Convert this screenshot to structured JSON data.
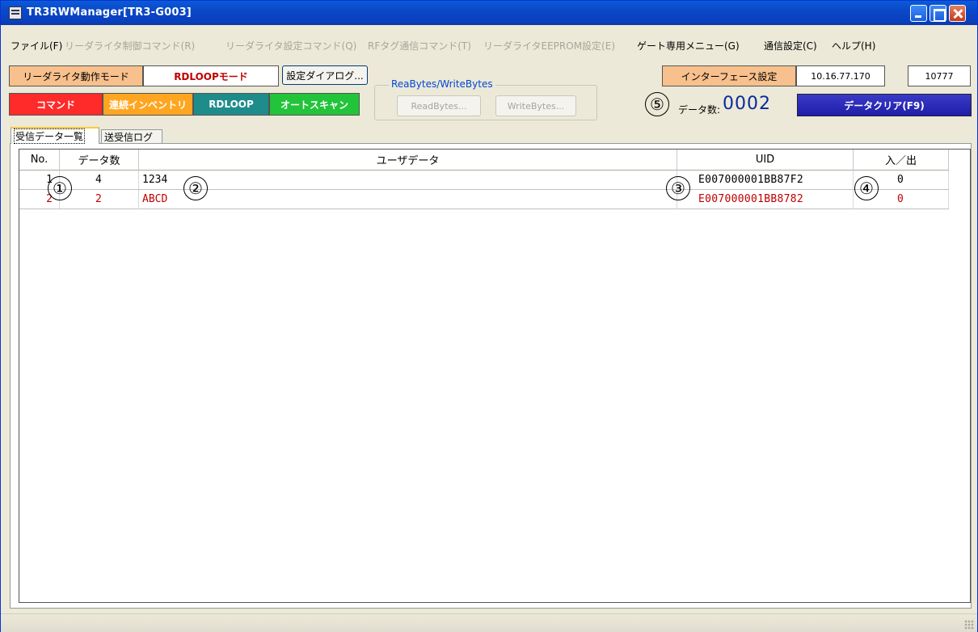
{
  "window": {
    "title": "TR3RWManager[TR3-G003]"
  },
  "menu": {
    "items": [
      {
        "label": "ファイル(F)",
        "enabled": true
      },
      {
        "label": "リーダライタ制御コマンド(R)",
        "enabled": false
      },
      {
        "label": "リーダライタ設定コマンド(Q)",
        "enabled": false
      },
      {
        "label": "RFタグ通信コマンド(T)",
        "enabled": false
      },
      {
        "label": "リーダライタEEPROM設定(E)",
        "enabled": false
      },
      {
        "label": "ゲート専用メニュー(G)",
        "enabled": true
      },
      {
        "label": "通信設定(C)",
        "enabled": true
      },
      {
        "label": "ヘルプ(H)",
        "enabled": true
      }
    ]
  },
  "toolbar": {
    "mode_label": "リーダライタ動作モード",
    "mode_value": "RDLOOPモード",
    "settings_dialog": "設定ダイアログ...",
    "commands": {
      "command": "コマンド",
      "inventory": "連続インベントリ",
      "rdloop": "RDLOOP",
      "autoscan": "オートスキャン"
    },
    "readwrite_group": {
      "title": "ReaBytes/WriteBytes",
      "read_button": "ReadBytes...",
      "write_button": "WriteBytes..."
    },
    "interface_label": "インターフェース設定",
    "ip_address": "10.16.77.170",
    "port": "10777",
    "data_count_label": "データ数:",
    "data_count_value": "0002",
    "clear_button": "データクリア(F9)"
  },
  "tabs": [
    {
      "label": "受信データ一覧",
      "active": true
    },
    {
      "label": "送受信ログ",
      "active": false
    }
  ],
  "table": {
    "headers": {
      "no": "No.",
      "count": "データ数",
      "user_data": "ユーザデータ",
      "uid": "UID",
      "io": "入／出"
    },
    "rows": [
      {
        "no": "1",
        "count": "4",
        "user_data": "1234",
        "uid": "E007000001BB87F2",
        "io": "0"
      },
      {
        "no": "2",
        "count": "2",
        "user_data": "ABCD",
        "uid": "E007000001BB8782",
        "io": "0"
      }
    ]
  },
  "callouts": {
    "c1": "①",
    "c2": "②",
    "c3": "③",
    "c4": "④",
    "c5": "⑤"
  },
  "colors": {
    "title_bar": "#0a48c8",
    "command_red": "#ff2a2a",
    "inventory_orange": "#ffa51f",
    "rdloop_teal": "#1f8c8c",
    "autoscan_green": "#22c43a",
    "clear_blue": "#2a2ab8",
    "label_orange": "#f7c08c",
    "highlight_row": "#c00000"
  }
}
